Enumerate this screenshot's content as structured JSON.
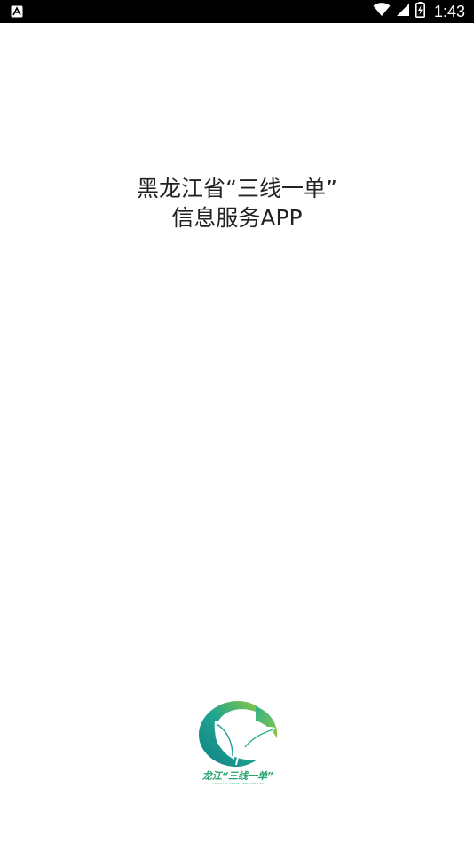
{
  "status_bar": {
    "time": "1:43",
    "icons": [
      "notification-a-icon",
      "wifi-icon",
      "cell-signal-icon",
      "battery-charging-icon"
    ]
  },
  "title": {
    "line1": "黑龙江省“三线一单”",
    "line2": "信息服务APP"
  },
  "logo": {
    "text": "龙江“三线一单”",
    "subtext": "LONGJIANG THREE LINES ONE LIST",
    "colors": {
      "green": "#8dc63f",
      "teal": "#1a9f8f",
      "dark_teal": "#0f7f86"
    }
  }
}
